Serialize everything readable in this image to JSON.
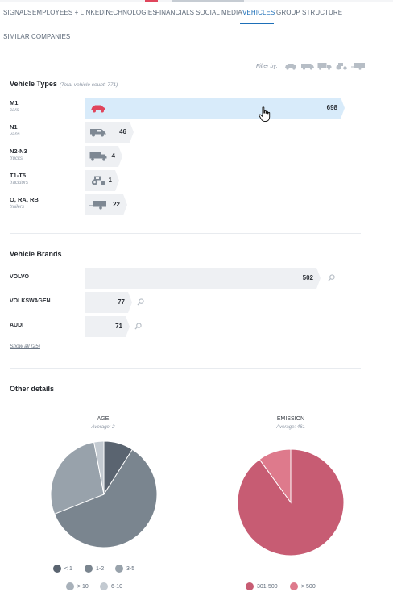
{
  "tabs": [
    {
      "label": "SIGNALS",
      "active": false
    },
    {
      "label": "EMPLOYEES + LINKEDIN",
      "active": false
    },
    {
      "label": "TECHNOLOGIES",
      "active": false
    },
    {
      "label": "FINANCIALS",
      "active": false
    },
    {
      "label": "SOCIAL MEDIA",
      "active": false
    },
    {
      "label": "VEHICLES",
      "active": true
    },
    {
      "label": "GROUP STRUCTURE",
      "active": false
    },
    {
      "label": "SIMILAR COMPANIES",
      "active": false
    }
  ],
  "filter": {
    "label": "Filter by:",
    "icons": [
      "car-icon",
      "van-icon",
      "truck-icon",
      "tractor-icon",
      "trailer-icon"
    ]
  },
  "vehicle_types": {
    "title": "Vehicle Types",
    "subtitle": "(Total vehicle count: 771)",
    "items": [
      {
        "name": "M1",
        "sub": "cars",
        "value": "698",
        "icon": "car-icon",
        "highlight": true
      },
      {
        "name": "N1",
        "sub": "vans",
        "value": "46",
        "icon": "van-icon",
        "highlight": false
      },
      {
        "name": "N2-N3",
        "sub": "trucks",
        "value": "4",
        "icon": "truck-icon",
        "highlight": false
      },
      {
        "name": "T1-T5",
        "sub": "tracktors",
        "value": "1",
        "icon": "tractor-icon",
        "highlight": false
      },
      {
        "name": "O, RA, RB",
        "sub": "trailers",
        "value": "22",
        "icon": "trailer-icon",
        "highlight": false
      }
    ]
  },
  "vehicle_brands": {
    "title": "Vehicle Brands",
    "items": [
      {
        "name": "VOLVO",
        "value": "502"
      },
      {
        "name": "VOLKSWAGEN",
        "value": "77"
      },
      {
        "name": "AUDI",
        "value": "71"
      }
    ],
    "show_all": "Show all (25)"
  },
  "other_details": {
    "title": "Other details",
    "age": {
      "title": "AGE",
      "subtitle": "Average: 2",
      "legend": [
        {
          "label": "< 1",
          "color": "#5a6470"
        },
        {
          "label": "1-2",
          "color": "#7a858f"
        },
        {
          "label": "3-5",
          "color": "#98a2ab"
        },
        {
          "label": "> 10",
          "color": "#a8b1ba"
        },
        {
          "label": "6-10",
          "color": "#c3cad1"
        }
      ],
      "slices": [
        {
          "label": "< 1",
          "value": 9
        },
        {
          "label": "1-2",
          "value": 60
        },
        {
          "label": "3-5",
          "value": 28
        },
        {
          "label": "6-10",
          "value": 3
        }
      ]
    },
    "emission": {
      "title": "EMISSION",
      "subtitle": "Average: 461",
      "legend": [
        {
          "label": "301-500",
          "color": "#c75c73"
        },
        {
          "label": "> 500",
          "color": "#de7a8c"
        }
      ],
      "slices": [
        {
          "label": "301-500",
          "value": 90
        },
        {
          "label": "> 500",
          "value": 10
        }
      ]
    }
  },
  "colors": {
    "accent": "#1d6fb8",
    "car_red": "#e0455c",
    "icon_grey": "#7e8893",
    "highlight_bar": "#d8ebfa",
    "bar": "#eef0f3"
  }
}
